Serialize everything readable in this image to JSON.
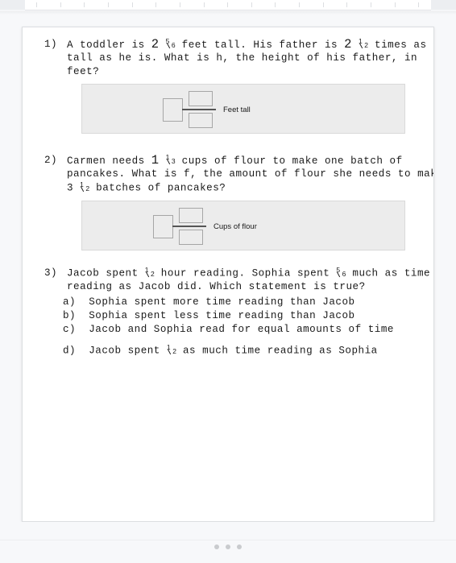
{
  "ruler": {
    "tick_count": 17,
    "icon": "ruler-ticks"
  },
  "document": {
    "questions": [
      {
        "number": "1)",
        "lines": [
          [
            {
              "t": "text",
              "v": "A toddler is "
            },
            {
              "t": "bignum",
              "v": "2"
            },
            {
              "t": "text",
              "v": " "
            },
            {
              "t": "frac",
              "num": "5",
              "den": "6"
            },
            {
              "t": "text",
              "v": " feet tall. His father is "
            },
            {
              "t": "bignum",
              "v": "2"
            },
            {
              "t": "text",
              "v": " "
            },
            {
              "t": "frac",
              "num": "1",
              "den": "2"
            },
            {
              "t": "text",
              "v": " times as"
            }
          ],
          [
            {
              "t": "text",
              "v": "tall as he is. What is h, the height of his father, in"
            }
          ],
          [
            {
              "t": "text",
              "v": "feet?"
            }
          ]
        ],
        "answer": {
          "whole_value": "",
          "numerator_value": "",
          "denominator_value": "",
          "unit_label": "Feet tall"
        }
      },
      {
        "number": "2)",
        "lines": [
          [
            {
              "t": "text",
              "v": "Carmen needs "
            },
            {
              "t": "bignum",
              "v": "1"
            },
            {
              "t": "text",
              "v": " "
            },
            {
              "t": "frac",
              "num": "1",
              "den": "3"
            },
            {
              "t": "text",
              "v": " cups of flour to make one batch of"
            }
          ],
          [
            {
              "t": "text",
              "v": "pancakes. What is f, the amount of flour she needs to make"
            }
          ],
          [
            {
              "t": "text",
              "v": "3 "
            },
            {
              "t": "frac",
              "num": "1",
              "den": "2"
            },
            {
              "t": "text",
              "v": " batches of pancakes?"
            }
          ]
        ],
        "answer": {
          "whole_value": "",
          "numerator_value": "",
          "denominator_value": "",
          "unit_label": "Cups of flour"
        }
      },
      {
        "number": "3)",
        "lines": [
          [
            {
              "t": "text",
              "v": "Jacob spent "
            },
            {
              "t": "frac",
              "num": "1",
              "den": "2"
            },
            {
              "t": "text",
              "v": " hour reading. Sophia spent "
            },
            {
              "t": "frac",
              "num": "5",
              "den": "6"
            },
            {
              "t": "text",
              "v": " much as time"
            }
          ],
          [
            {
              "t": "text",
              "v": "reading as Jacob did. Which statement is true?"
            }
          ]
        ],
        "options": [
          [
            {
              "t": "text",
              "v": "a)  Sophia spent more time reading than Jacob"
            }
          ],
          [
            {
              "t": "text",
              "v": "b)  Sophia spent less time reading than Jacob"
            }
          ],
          [
            {
              "t": "text",
              "v": "c)  Jacob and Sophia read for equal amounts of time"
            }
          ],
          [
            {
              "t": "text",
              "v": "d)  Jacob spent "
            },
            {
              "t": "frac",
              "num": "1",
              "den": "2"
            },
            {
              "t": "text",
              "v": " as much time reading as Sophia"
            }
          ]
        ]
      }
    ]
  },
  "footer": {
    "dot_count": 3
  },
  "colors": {
    "page_background": "#ffffff",
    "app_background": "#f7f8fa",
    "answer_panel": "#ececec",
    "answer_panel_border": "#d9d9d9",
    "input_border": "#a6a6a6",
    "text": "#1a1a1a",
    "dot": "#c9cbce"
  }
}
